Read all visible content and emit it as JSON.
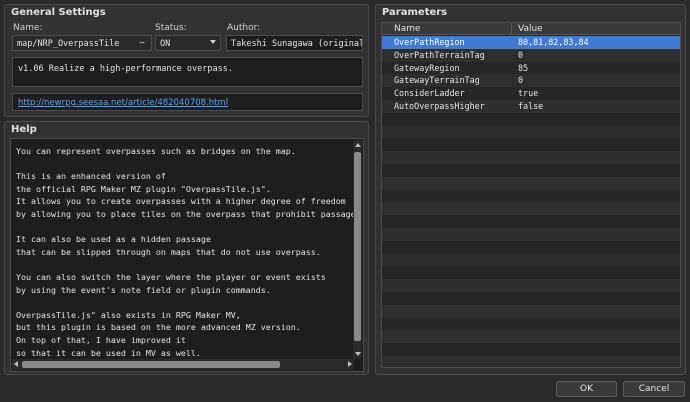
{
  "general": {
    "title": "General Settings",
    "name_label": "Name:",
    "name_value": "map/NRP_OverpassTile",
    "name_button": "⋯",
    "status_label": "Status:",
    "status_value": "ON",
    "author_label": "Author:",
    "author_value": "Takeshi Sunagawa (original",
    "description": "v1.06 Realize a high-performance overpass.",
    "url": "http://newrpg.seesaa.net/article/482040708.html"
  },
  "help": {
    "title": "Help",
    "lines": [
      "You can represent overpasses such as bridges on the map.",
      "",
      "This is an enhanced version of",
      "the official RPG Maker MZ plugin \"OverpassTile.js\".",
      "It allows you to create overpasses with a higher degree of freedom",
      "by allowing you to place tiles on the overpass that prohibit passage.",
      "",
      "It can also be used as a hidden passage",
      "that can be slipped through on maps that do not use overpass.",
      "",
      "You can also switch the layer where the player or event exists",
      "by using the event's note field or plugin commands.",
      "",
      "OverpassTile.js\" also exists in RPG Maker MV,",
      "but this plugin is based on the more advanced MZ version.",
      "On top of that, I have improved it",
      "so that it can be used in MV as well."
    ]
  },
  "parameters": {
    "title": "Parameters",
    "col_name": "Name",
    "col_value": "Value",
    "rows": [
      {
        "name": "OverPathRegion",
        "value": "80,81,82,83,84"
      },
      {
        "name": "OverPathTerrainTag",
        "value": "0"
      },
      {
        "name": "GatewayRegion",
        "value": "85"
      },
      {
        "name": "GatewayTerrainTag",
        "value": "0"
      },
      {
        "name": "ConsiderLadder",
        "value": "true"
      },
      {
        "name": "AutoOverpassHigher",
        "value": "false"
      }
    ],
    "selected_index": 0,
    "empty_rows": 20
  },
  "buttons": {
    "ok": "OK",
    "cancel": "Cancel"
  },
  "colors": {
    "background": "#2b2b2b",
    "selection": "#3d7bd6",
    "link": "#4fa3ff"
  }
}
